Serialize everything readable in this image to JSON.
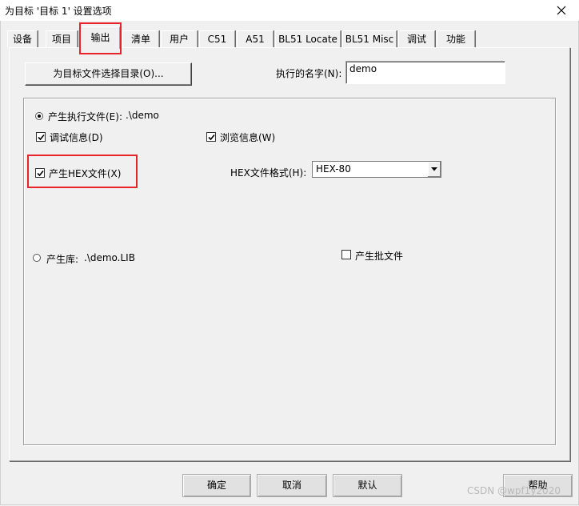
{
  "window": {
    "title": "为目标 '目标 1' 设置选项"
  },
  "tabs": [
    {
      "label": "设备"
    },
    {
      "label": "项目"
    },
    {
      "label": "输出"
    },
    {
      "label": "清单"
    },
    {
      "label": "用户"
    },
    {
      "label": "C51"
    },
    {
      "label": "A51"
    },
    {
      "label": "BL51 Locate"
    },
    {
      "label": "BL51 Misc"
    },
    {
      "label": "调试"
    },
    {
      "label": "功能"
    }
  ],
  "output": {
    "select_folder_button": "为目标文件选择目录(O)...",
    "exec_name_label": "执行的名字(N):",
    "exec_name_value": "demo",
    "create_exec_label": "产生执行文件(E):",
    "create_exec_path": ".\\demo",
    "debug_info_label": "调试信息(D)",
    "browse_info_label": "浏览信息(W)",
    "create_hex_label": "产生HEX文件(X)",
    "hex_format_label": "HEX文件格式(H):",
    "hex_format_value": "HEX-80",
    "create_lib_label": "产生库:",
    "create_lib_path": ".\\demo.LIB",
    "create_batch_label": "产生批文件"
  },
  "buttons": {
    "ok": "确定",
    "cancel": "取消",
    "defaults": "默认",
    "help": "帮助"
  },
  "watermark": "CSDN @wpf1y2020"
}
